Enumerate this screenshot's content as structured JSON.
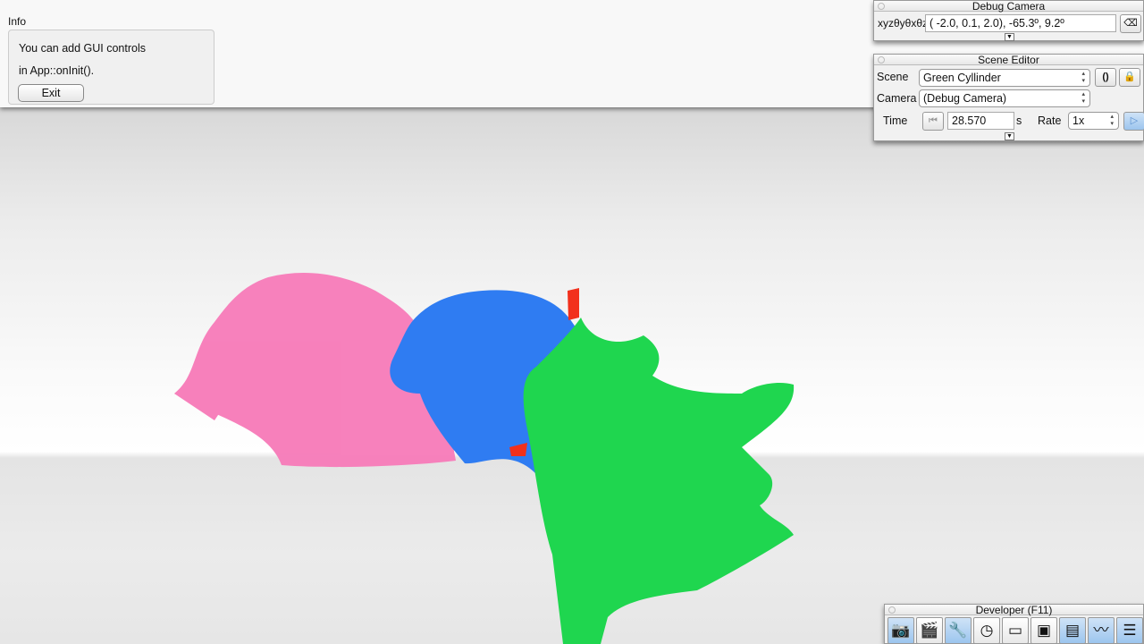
{
  "info": {
    "title": "Info",
    "line1": "You can add GUI controls",
    "line2": "in App::onInit().",
    "exit_label": "Exit"
  },
  "debug_camera": {
    "title": "Debug Camera",
    "label": "xyzθyθxθz",
    "value": "( -2.0,   0.1,   2.0), -65.3º,   9.2º",
    "copy_icon": "eraser-icon"
  },
  "scene_editor": {
    "title": "Scene Editor",
    "scene_label": "Scene",
    "scene_value": "Green Cyllinder",
    "reload_glyph": "()",
    "camera_label": "Camera",
    "camera_value": "(Debug Camera)",
    "time_label": "Time",
    "time_value": "28.570",
    "time_unit": "s",
    "rate_label": "Rate",
    "rate_value": "1x"
  },
  "developer": {
    "title": "Developer (F11)",
    "buttons": [
      {
        "icon": "camera-icon",
        "glyph": "📷",
        "on": true
      },
      {
        "icon": "clapperboard-icon",
        "glyph": "🎬",
        "on": false
      },
      {
        "icon": "tools-icon",
        "glyph": "🔧",
        "on": true
      },
      {
        "icon": "clock-icon",
        "glyph": "◷",
        "on": false
      },
      {
        "icon": "window-icon",
        "glyph": "▭",
        "on": false
      },
      {
        "icon": "console-icon",
        "glyph": "▣",
        "on": false
      },
      {
        "icon": "layout-icon",
        "glyph": "▤",
        "on": true
      },
      {
        "icon": "profiler-icon",
        "glyph": "〰",
        "on": true
      },
      {
        "icon": "document-icon",
        "glyph": "☰",
        "on": true
      }
    ]
  },
  "colors": {
    "pink": "#f77ab8",
    "blue": "#2f7cf2",
    "green": "#1fd64f",
    "red": "#f2301c"
  }
}
